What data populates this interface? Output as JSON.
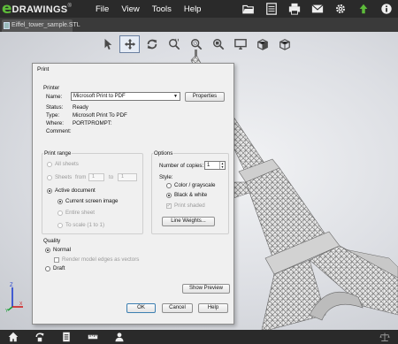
{
  "app": {
    "logo_e": "e",
    "logo_rest": "DRAWINGS",
    "logo_mark": "®",
    "menu": [
      "File",
      "View",
      "Tools",
      "Help"
    ],
    "top_icons": [
      "folder-open-icon",
      "document-icon",
      "print-icon",
      "mail-icon",
      "gear-icon",
      "upload-icon",
      "info-icon"
    ]
  },
  "tab": {
    "label": "Eiffel_tower_sample.STL"
  },
  "view_tools": [
    "select-arrow-icon",
    "pan-icon",
    "rotate-icon",
    "zoom-area-icon",
    "zoom-icon",
    "zoom-fit-icon",
    "display-icon",
    "section-icon",
    "view-cube-icon"
  ],
  "dialog": {
    "title": "Print",
    "printer": {
      "group": "Printer",
      "name_label": "Name:",
      "name_value": "Microsoft Print to PDF",
      "properties": "Properties",
      "status_label": "Status:",
      "status_value": "Ready",
      "type_label": "Type:",
      "type_value": "Microsoft Print To PDF",
      "where_label": "Where:",
      "where_value": "PORTPROMPT:",
      "comment_label": "Comment:",
      "comment_value": ""
    },
    "print_range": {
      "group": "Print range",
      "all_sheets": "All sheets",
      "sheets": "Sheets",
      "from": "from",
      "to": "to",
      "from_value": "1",
      "to_value": "1",
      "active_document": "Active document",
      "current_screen": "Current screen image",
      "entire_sheet": "Entire sheet",
      "to_scale": "To scale (1 to 1)"
    },
    "options": {
      "group": "Options",
      "copies_label": "Number of copies:",
      "copies_value": "1",
      "style_label": "Style:",
      "color": "Color / grayscale",
      "bw": "Black & white",
      "print_shaded": "Print shaded",
      "line_weights": "Line Weights..."
    },
    "quality": {
      "group": "Quality",
      "normal": "Normal",
      "render_edges": "Render model edges as vectors",
      "draft": "Draft"
    },
    "show_preview": "Show Preview",
    "ok": "OK",
    "cancel": "Cancel",
    "help": "Help"
  },
  "axis": {
    "x": "X",
    "y": "Y",
    "z": "Z"
  },
  "bottom_icons": [
    "home-icon",
    "refresh-icon",
    "document-icon",
    "measure-icon",
    "user-icon",
    "scale-icon"
  ],
  "colors": {
    "brand_green": "#5dbb3a",
    "menubar": "#2a2a2a",
    "dialog_bg": "#f0f0f0"
  }
}
